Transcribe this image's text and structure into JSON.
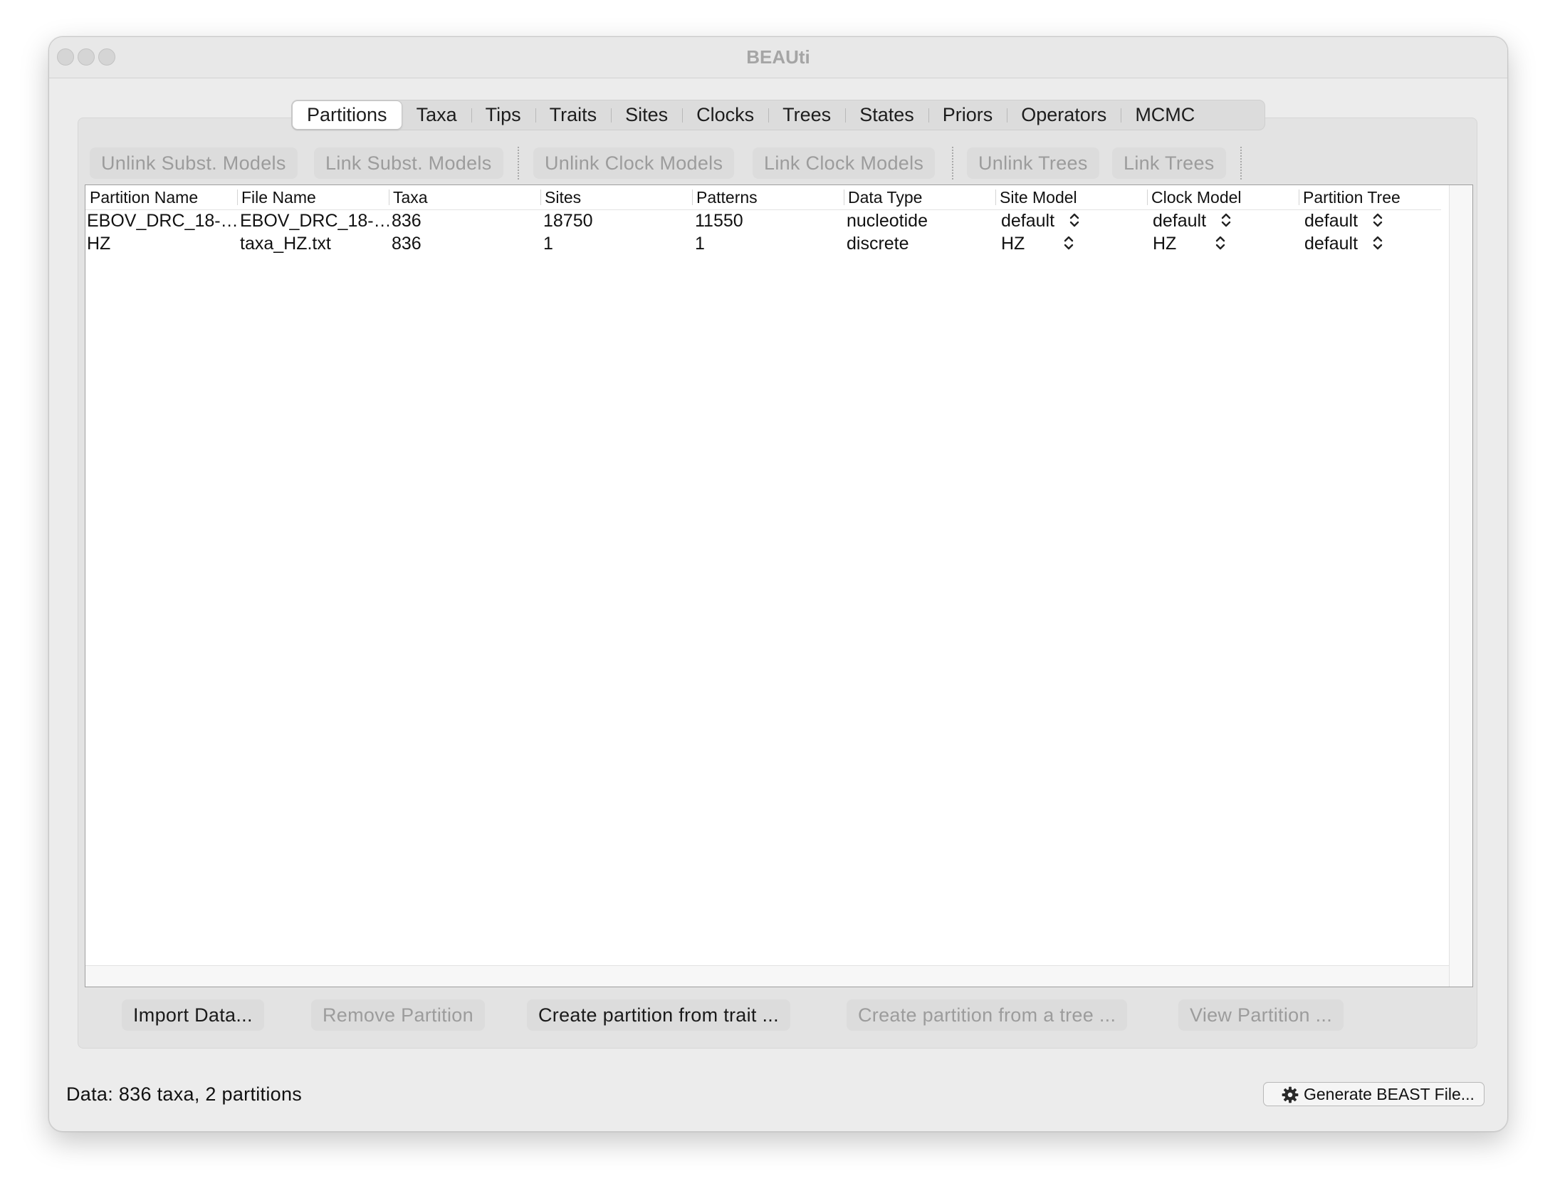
{
  "window": {
    "title": "BEAUti"
  },
  "tabs": [
    {
      "label": "Partitions",
      "active": true
    },
    {
      "label": "Taxa"
    },
    {
      "label": "Tips"
    },
    {
      "label": "Traits"
    },
    {
      "label": "Sites"
    },
    {
      "label": "Clocks"
    },
    {
      "label": "Trees"
    },
    {
      "label": "States"
    },
    {
      "label": "Priors"
    },
    {
      "label": "Operators"
    },
    {
      "label": "MCMC"
    }
  ],
  "toolbar": {
    "unlink_subst": "Unlink Subst. Models",
    "link_subst": "Link Subst. Models",
    "unlink_clock": "Unlink Clock Models",
    "link_clock": "Link Clock Models",
    "unlink_trees": "Unlink Trees",
    "link_trees": "Link Trees"
  },
  "table": {
    "columns": [
      "Partition Name",
      "File Name",
      "Taxa",
      "Sites",
      "Patterns",
      "Data Type",
      "Site Model",
      "Clock Model",
      "Partition Tree"
    ],
    "rows": [
      {
        "partition_name": "EBOV_DRC_18-…",
        "file_name": "EBOV_DRC_18-…",
        "taxa": "836",
        "sites": "18750",
        "patterns": "11550",
        "data_type": "nucleotide",
        "site_model": "default",
        "clock_model": "default",
        "partition_tree": "default"
      },
      {
        "partition_name": "HZ",
        "file_name": "taxa_HZ.txt",
        "taxa": "836",
        "sites": "1",
        "patterns": "1",
        "data_type": "discrete",
        "site_model": "HZ",
        "clock_model": "HZ",
        "partition_tree": "default"
      }
    ]
  },
  "buttons": {
    "import_data": "Import Data...",
    "remove_partition": "Remove Partition",
    "create_from_trait": "Create partition from trait ...",
    "create_from_tree": "Create partition from a tree ...",
    "view_partition": "View Partition ..."
  },
  "status": {
    "text": "Data: 836 taxa, 2 partitions"
  },
  "generate": {
    "label": "Generate BEAST File..."
  },
  "icons": {
    "generate": "gear-icon",
    "combo": "chevron-up-down-icon"
  }
}
